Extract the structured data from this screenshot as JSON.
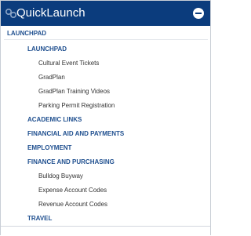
{
  "quicklaunch": {
    "title": "QuickLaunch",
    "header_icon": "links-icon",
    "collapse_icon": "minus-circle-icon",
    "accent_color": "#0b3c7d",
    "heading_color": "#1f4f8f"
  },
  "menu": {
    "launchpad_root": "LAUNCHPAD",
    "launchpad": "LAUNCHPAD",
    "launchpad_links": [
      "Cultural Event Tickets",
      "GradPlan",
      "GradPlan Training Videos",
      "Parking Permit Registration"
    ],
    "academic_links": "ACADEMIC LINKS",
    "financial_aid": "FINANCIAL AID AND PAYMENTS",
    "employment": "EMPLOYMENT",
    "finance_purchasing": "FINANCE AND PURCHASING",
    "finance_links": [
      "Bulldog Buyway",
      "Expense Account Codes",
      "Revenue Account Codes"
    ],
    "travel": "TRAVEL"
  }
}
